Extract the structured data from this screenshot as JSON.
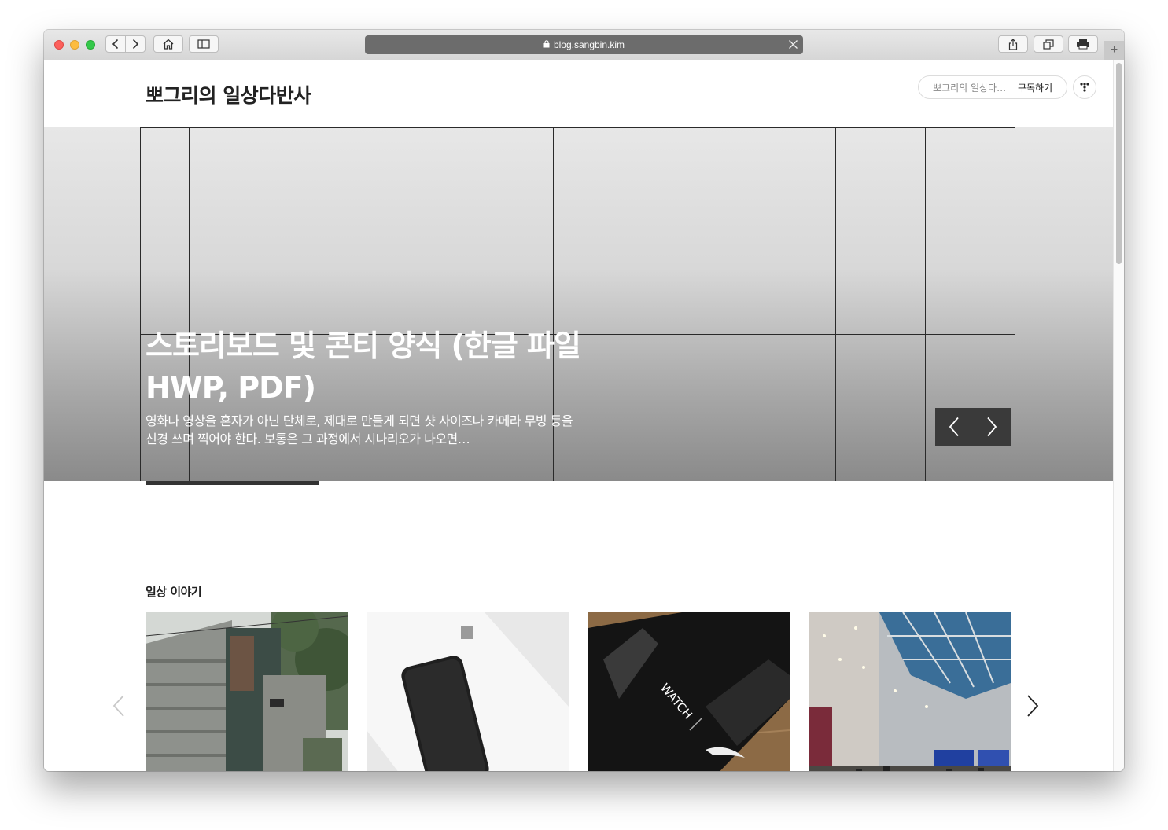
{
  "browser": {
    "url": "blog.sangbin.kim",
    "new_tab_label": "+"
  },
  "blog": {
    "title": "뽀그리의 일상다반사",
    "subscribe_name": "뽀그리의 일상다…",
    "subscribe_label": "구독하기"
  },
  "hero": {
    "title": "스토리보드 및 콘티 양식 (한글 파일 HWP, PDF)",
    "description": "영화나 영상을 혼자가 아닌 단체로, 제대로 만들게 되면 샷 사이즈나 카메라 무빙 등을 신경 쓰며 찍어야 한다. 보통은 그 과정에서 시나리오가 나오면…"
  },
  "section": {
    "title": "일상 이야기"
  },
  "icons": {
    "back": "chevron-left-icon",
    "forward": "chevron-right-icon",
    "home": "home-icon",
    "sidebar": "sidebar-icon",
    "share": "share-icon",
    "tabs": "tabs-icon",
    "print": "print-icon",
    "lock": "lock-icon",
    "menu": "tistory-menu-icon"
  },
  "colors": {
    "close": "#fc605c",
    "minimize": "#fdbc40",
    "zoom": "#34c84a",
    "url_bar": "#6c6c6c"
  }
}
